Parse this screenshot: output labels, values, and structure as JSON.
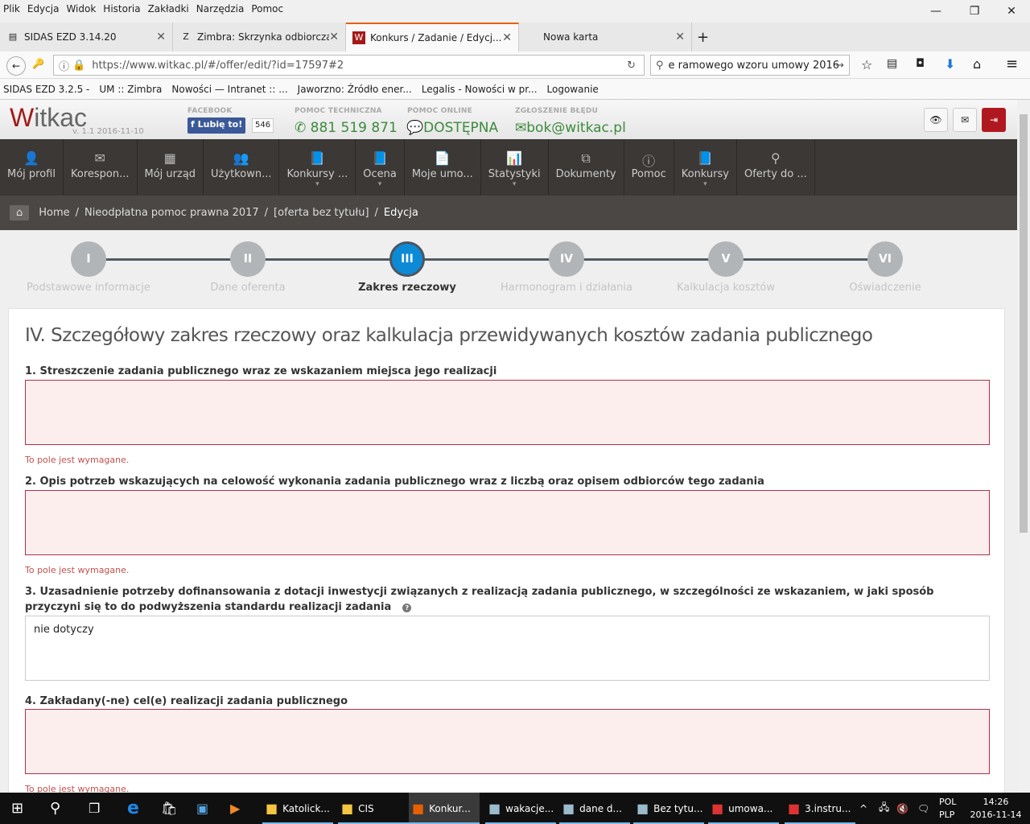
{
  "browser": {
    "menu": [
      "Plik",
      "Edycja",
      "Widok",
      "Historia",
      "Zakładki",
      "Narzędzia",
      "Pomoc"
    ],
    "tabs": [
      {
        "label": "SIDAS EZD 3.14.20",
        "icon": "doc-icon"
      },
      {
        "label": "Zimbra: Skrzynka odbiorcza",
        "icon": "zimbra-icon"
      },
      {
        "label": "Konkurs / Zadanie / Edycj...",
        "icon": "witkac-icon",
        "active": true
      },
      {
        "label": "Nowa karta",
        "icon": ""
      }
    ],
    "url": "https://www.witkac.pl/#/offer/edit/?id=17597#2",
    "search": "e ramowego wzoru umowy 2016",
    "bookmarks": [
      "SIDAS EZD 3.2.5 -",
      "UM :: Zimbra",
      "Nowości — Intranet :: ...",
      "Jaworzno: Źródło ener...",
      "Legalis - Nowości w pr...",
      "Logowanie"
    ]
  },
  "header": {
    "logo": "Witkac",
    "version": "v. 1.1 2016-11-10",
    "facebook_label": "FACEBOOK",
    "like_label": "Lubię to!",
    "like_count": "546",
    "tech_label": "POMOC TECHNICZNA",
    "phone": "881 519 871",
    "online_label": "POMOC ONLINE",
    "online_status": "DOSTĘPNA",
    "bug_label": "ZGŁOSZENIE BŁĘDU",
    "email": "bok@witkac.pl"
  },
  "nav": [
    {
      "label": "Mój profil",
      "icon": "user-icon"
    },
    {
      "label": "Korespon...",
      "icon": "envelope-icon"
    },
    {
      "label": "Mój urząd",
      "icon": "building-icon"
    },
    {
      "label": "Użytkown...",
      "icon": "users-icon"
    },
    {
      "label": "Konkursy ...",
      "icon": "book-icon",
      "dropdown": true
    },
    {
      "label": "Ocena",
      "icon": "book-icon",
      "dropdown": true
    },
    {
      "label": "Moje umo...",
      "icon": "file-icon"
    },
    {
      "label": "Statystyki",
      "icon": "chart-icon",
      "dropdown": true
    },
    {
      "label": "Dokumenty",
      "icon": "copy-icon"
    },
    {
      "label": "Pomoc",
      "icon": "info-icon"
    },
    {
      "label": "Konkursy",
      "icon": "book-icon",
      "dropdown": true
    },
    {
      "label": "Oferty do ...",
      "icon": "search-icon"
    }
  ],
  "breadcrumb": [
    "Home",
    "Nieodpłatna pomoc prawna 2017",
    "[oferta bez tytułu]",
    "Edycja"
  ],
  "steps": [
    {
      "num": "I",
      "label": "Podstawowe informacje"
    },
    {
      "num": "II",
      "label": "Dane oferenta"
    },
    {
      "num": "III",
      "label": "Zakres rzeczowy",
      "active": true
    },
    {
      "num": "IV",
      "label": "Harmonogram i działania"
    },
    {
      "num": "V",
      "label": "Kalkulacja kosztów"
    },
    {
      "num": "VI",
      "label": "Oświadczenie"
    }
  ],
  "form": {
    "title": "IV. Szczegółowy zakres rzeczowy oraz kalkulacja przewidywanych kosztów zadania publicznego",
    "required_msg": "To pole jest wymagane.",
    "fields": [
      {
        "label": "1. Streszczenie zadania publicznego wraz ze wskazaniem miejsca jego realizacji",
        "value": "",
        "error": true
      },
      {
        "label": "2. Opis potrzeb wskazujących na celowość wykonania zadania publicznego wraz z liczbą oraz opisem odbiorców tego zadania",
        "value": "",
        "error": true
      },
      {
        "label": "3. Uzasadnienie potrzeby dofinansowania z dotacji inwestycji związanych z realizacją zadania publicznego, w szczególności ze wskazaniem, w jaki sposób przyczyni się to do podwyższenia standardu realizacji zadania",
        "value": "nie dotyczy",
        "error": false,
        "help": true
      },
      {
        "label": "4. Zakładany(-ne) cel(e) realizacji zadania publicznego",
        "value": "",
        "error": true
      }
    ]
  },
  "taskbar": {
    "apps": [
      "Katolick...",
      "CIS",
      "Konkur...",
      "wakacje...",
      "dane d...",
      "Bez tytu...",
      "umowa...",
      "3.instru..."
    ],
    "lang": "POL",
    "layout": "PLP",
    "time": "14:26",
    "date": "2016-11-14"
  },
  "colors": {
    "accent": "#0d8ad6",
    "error": "#c0504d",
    "nav_bg": "#3b3835",
    "green": "#3c8a3c"
  }
}
